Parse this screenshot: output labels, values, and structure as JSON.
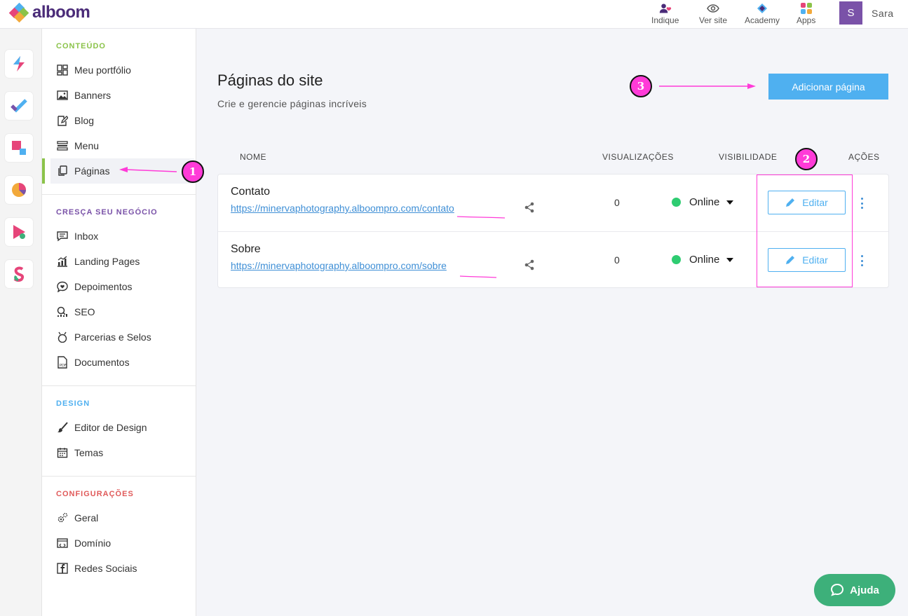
{
  "brand": {
    "name": "alboom"
  },
  "topnav": [
    {
      "label": "Indique",
      "icon": "refer-icon"
    },
    {
      "label": "Ver site",
      "icon": "eye-icon"
    },
    {
      "label": "Academy",
      "icon": "academy-icon"
    },
    {
      "label": "Apps",
      "icon": "apps-grid-icon"
    }
  ],
  "user": {
    "initial": "S",
    "name": "Sara"
  },
  "sidebar": {
    "sections": [
      {
        "title": "CONTEÚDO",
        "color": "#8bc34a",
        "items": [
          "Meu portfólio",
          "Banners",
          "Blog",
          "Menu",
          "Páginas"
        ]
      },
      {
        "title": "CRESÇA SEU NEGÓCIO",
        "color": "#7a52a8",
        "items": [
          "Inbox",
          "Landing Pages",
          "Depoimentos",
          "SEO",
          "Parcerias e Selos",
          "Documentos"
        ]
      },
      {
        "title": "DESIGN",
        "color": "#4fb0f0",
        "items": [
          "Editor de Design",
          "Temas"
        ]
      },
      {
        "title": "CONFIGURAÇÕES",
        "color": "#e05a5a",
        "items": [
          "Geral",
          "Domínio",
          "Redes Sociais"
        ]
      }
    ],
    "active_item": "Páginas"
  },
  "page": {
    "title": "Páginas do site",
    "subtitle": "Crie e gerencie páginas incríveis",
    "add_button": "Adicionar página"
  },
  "table": {
    "headers": {
      "name": "NOME",
      "views": "VISUALIZAÇÕES",
      "visibility": "VISIBILIDADE",
      "actions": "AÇÕES"
    },
    "rows": [
      {
        "name": "Contato",
        "url": "https://minervaphotography.alboompro.com/contato",
        "views": "0",
        "visibility": "Online",
        "edit": "Editar"
      },
      {
        "name": "Sobre",
        "url": "https://minervaphotography.alboompro.com/sobre",
        "views": "0",
        "visibility": "Online",
        "edit": "Editar"
      }
    ]
  },
  "annotations": {
    "badge1": "1",
    "badge2": "2",
    "badge3": "3"
  },
  "help": {
    "label": "Ajuda"
  },
  "colors": {
    "accent": "#4fb0f0",
    "online": "#2ecc71",
    "annotation": "#ff3bd8",
    "help": "#3db07a"
  }
}
